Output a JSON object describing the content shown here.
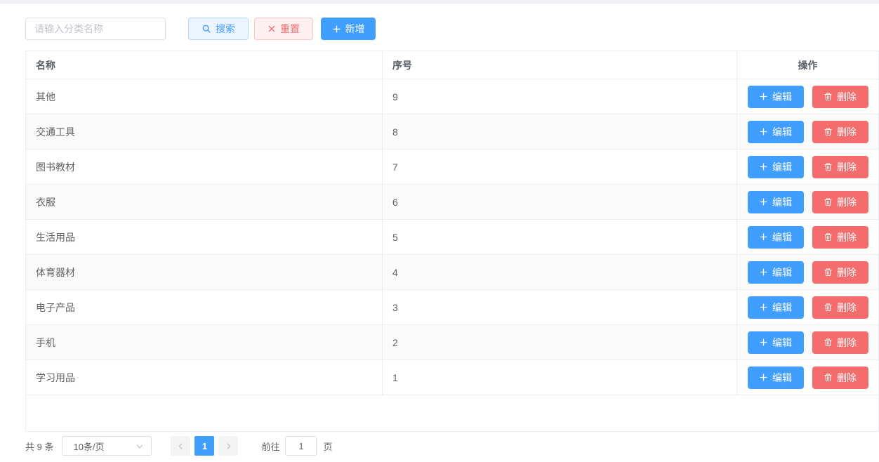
{
  "toolbar": {
    "search_input": {
      "placeholder": "请输入分类名称",
      "value": ""
    },
    "search_label": "搜索",
    "reset_label": "重置",
    "add_label": "新增"
  },
  "table": {
    "columns": {
      "name": "名称",
      "order": "序号",
      "actions": "操作"
    },
    "edit_label": "编辑",
    "delete_label": "删除",
    "rows": [
      {
        "name": "其他",
        "order": "9"
      },
      {
        "name": "交通工具",
        "order": "8"
      },
      {
        "name": "图书教材",
        "order": "7"
      },
      {
        "name": "衣服",
        "order": "6"
      },
      {
        "name": "生活用品",
        "order": "5"
      },
      {
        "name": "体育器材",
        "order": "4"
      },
      {
        "name": "电子产品",
        "order": "3"
      },
      {
        "name": "手机",
        "order": "2"
      },
      {
        "name": "学习用品",
        "order": "1"
      }
    ]
  },
  "pagination": {
    "total_text": "共 9 条",
    "page_size_value": "10条/页",
    "current_page": "1",
    "goto_label": "前往",
    "goto_value": "1",
    "page_unit": "页"
  },
  "colors": {
    "primary": "#409eff",
    "primary_plain_bg": "#ecf5ff",
    "primary_plain_border": "#b3d8ff",
    "danger": "#f56c6c",
    "danger_plain_bg": "#fef0f0",
    "danger_plain_border": "#fbc4c4",
    "table_border": "#ebeef5",
    "stripe_row_bg": "#fafafa",
    "text": "#606266",
    "placeholder_text": "#c0c4cc"
  }
}
